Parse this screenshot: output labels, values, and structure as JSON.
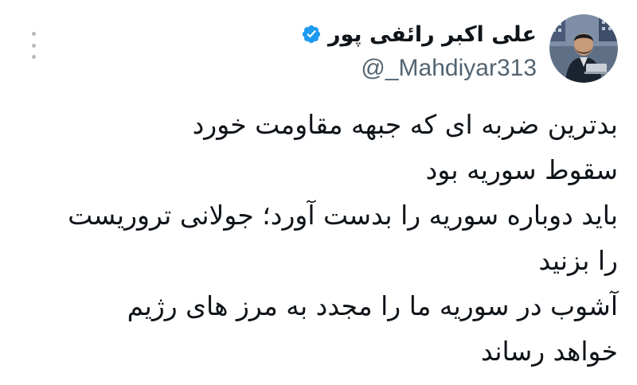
{
  "tweet": {
    "author": {
      "display_name": "علی اکبر رائفی پور",
      "handle": "@_Mahdiyar313",
      "verified": true,
      "verified_color": "#1d9bf0",
      "avatar_icon": "profile-photo"
    },
    "more_icon": "vertical-ellipsis-icon",
    "text_lines": [
      "بدترین ضربه ای که جبهه مقاومت خورد",
      "سقوط سوریه بود",
      "باید دوباره سوریه را بدست آورد؛ جولانی تروریست",
      "را بزنید",
      "آشوب در سوریه ما را مجدد به مرز های رژیم",
      "خواهد رساند"
    ]
  }
}
